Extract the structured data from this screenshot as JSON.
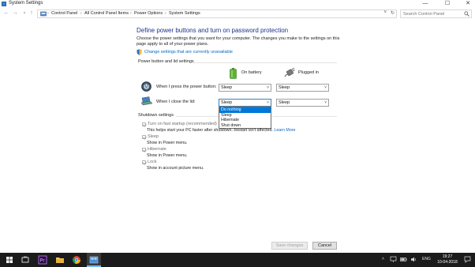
{
  "window": {
    "title": "System Settings",
    "minimize": "—",
    "maximize": "☐",
    "close": "✕"
  },
  "nav": {
    "back": "←",
    "forward": "→",
    "recent": "˅",
    "up": "↑",
    "breadcrumbs": [
      "Control Panel",
      "All Control Panel Items",
      "Power Options",
      "System Settings"
    ],
    "separator": "›",
    "dropdown": "˅",
    "refresh": "↻",
    "search_placeholder": "Search Control Panel"
  },
  "page": {
    "heading": "Define power buttons and turn on password protection",
    "description": "Choose the power settings that you want for your computer. The changes you make to the settings on this page apply to all of your power plans.",
    "unavailable_link": "Change settings that are currently unavailable"
  },
  "power_section": {
    "title": "Power button and lid settings",
    "col_battery": "On battery",
    "col_plugged": "Plugged in",
    "rows": [
      {
        "label": "When I press the power button:",
        "battery": "Sleep",
        "plugged": "Sleep"
      },
      {
        "label": "When I close the lid:",
        "battery": "Sleep",
        "plugged": "Sleep"
      }
    ],
    "dropdown_options": [
      "Do nothing",
      "Sleep",
      "Hibernate",
      "Shut down"
    ],
    "dropdown_highlighted": "Do nothing"
  },
  "shutdown_section": {
    "title": "Shutdown settings",
    "items": [
      {
        "label": "Turn on fast startup (recommended)",
        "desc": "This helps start your PC faster after shutdown. Restart isn't affected.",
        "link": "Learn More",
        "checked": true
      },
      {
        "label": "Sleep",
        "desc": "Show in Power menu.",
        "checked": true
      },
      {
        "label": "Hibernate",
        "desc": "Show in Power menu.",
        "checked": true
      },
      {
        "label": "Lock",
        "desc": "Show in account picture menu.",
        "checked": true
      }
    ]
  },
  "buttons": {
    "save": "Save changes",
    "cancel": "Cancel"
  },
  "taskbar": {
    "language": "ENG",
    "time": "19:27",
    "date": "10-04-2018"
  },
  "colors": {
    "heading": "#1e3287",
    "link": "#0a66c2",
    "highlight": "#0078d7",
    "taskbar": "#1b1b1b"
  }
}
